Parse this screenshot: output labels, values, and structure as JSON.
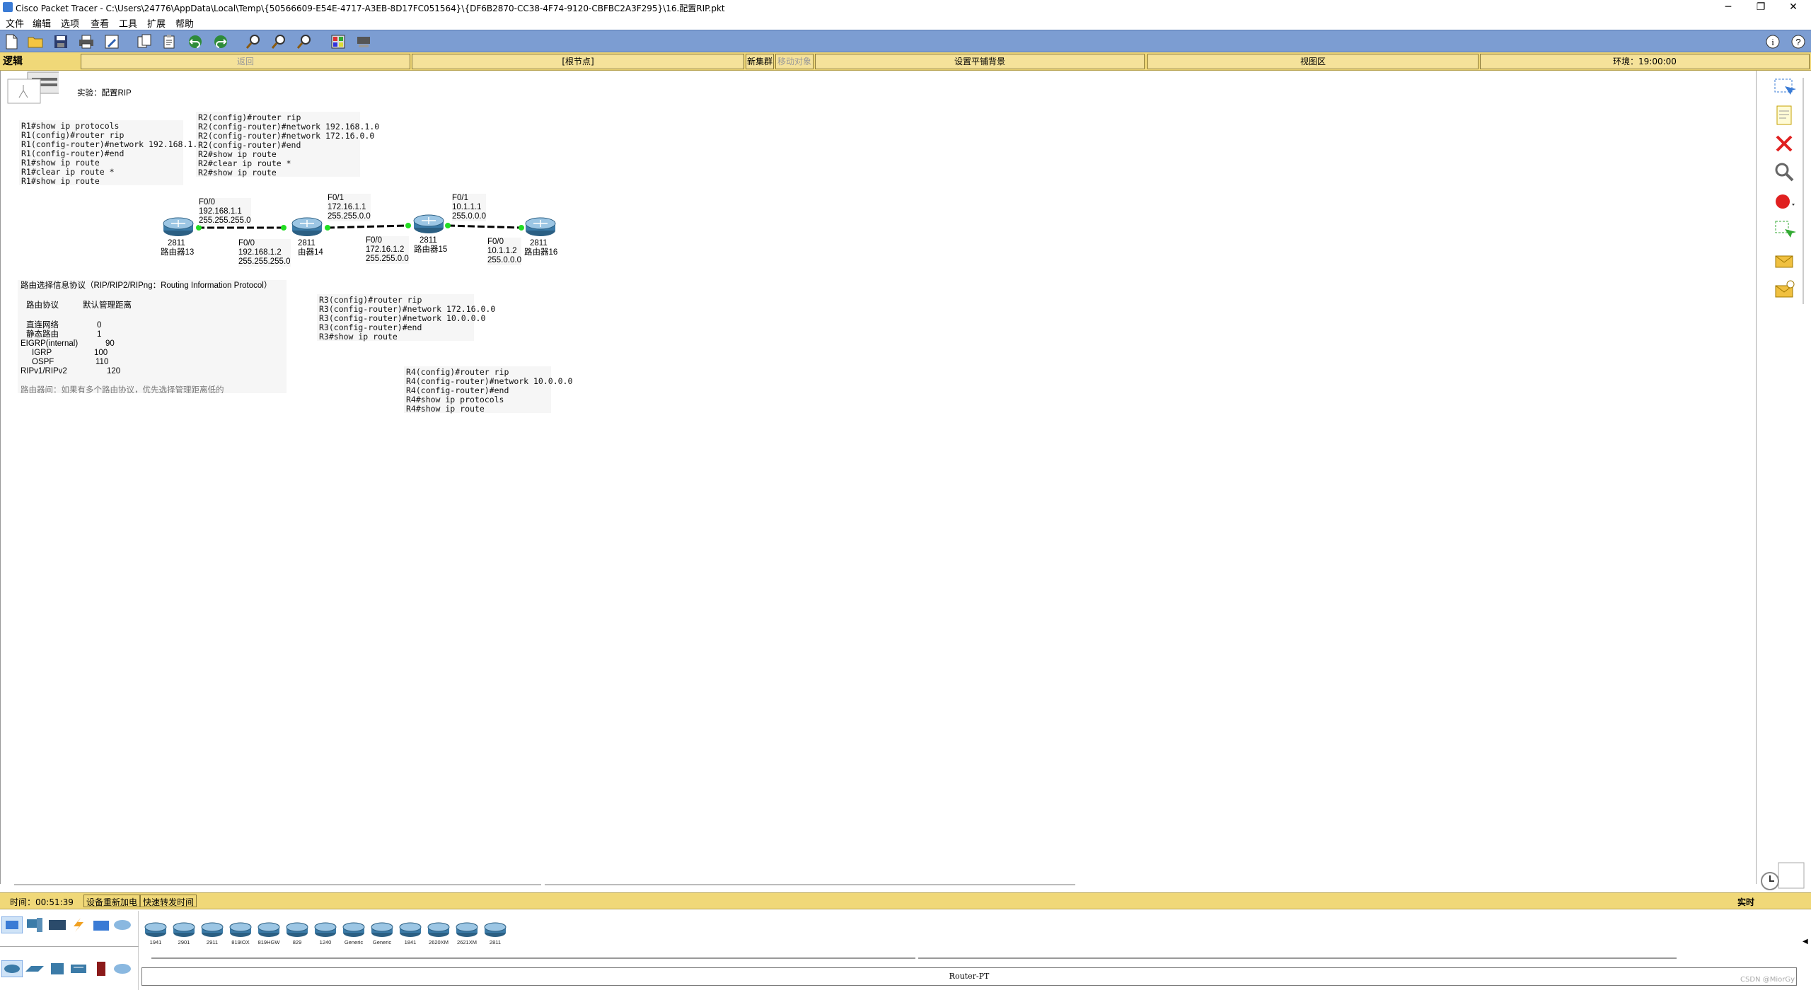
{
  "window": {
    "title": "Cisco Packet Tracer - C:\\Users\\24776\\AppData\\Local\\Temp\\{50566609-E54E-4717-A3EB-8D17FC051564}\\{DF6B2870-CC38-4F74-9120-CBFBC2A3F295}\\16.配置RIP.pkt",
    "minimize": "─",
    "maximize": "❐",
    "close": "✕"
  },
  "menu": [
    "文件",
    "编辑",
    "选项",
    "查看",
    "工具",
    "扩展",
    "帮助"
  ],
  "toolbar": {
    "icons": [
      "new-file-icon",
      "open-folder-icon",
      "save-icon",
      "print-icon",
      "activity-wizard-icon",
      "copy-icon",
      "paste-icon",
      "undo-icon",
      "redo-icon",
      "zoom-in-icon",
      "zoom-reset-icon",
      "zoom-out-icon",
      "palette-icon",
      "custom-device-icon"
    ],
    "right_icons": [
      "info-icon",
      "help-icon"
    ]
  },
  "nav": {
    "logic": "逻辑",
    "back": "返回",
    "root": "[根节点]",
    "new_cluster": "新集群",
    "move_object": "移动对象",
    "set_tiled_bg": "设置平铺背景",
    "viewport": "视图区",
    "environment": "环境：19:00:00"
  },
  "workspace": {
    "experiment_title": "实验：配置RIP",
    "notes": {
      "r1": "R1#show ip protocols\nR1(config)#router rip\nR1(config-router)#network 192.168.1.0\nR1(config-router)#end\nR1#show ip route\nR1#clear ip route *\nR1#show ip route",
      "r2": "R2(config)#router rip\nR2(config-router)#network 192.168.1.0\nR2(config-router)#network 172.16.0.0\nR2(config-router)#end\nR2#show ip route\nR2#clear ip route *\nR2#show ip route",
      "r3": "R3(config)#router rip\nR3(config-router)#network 172.16.0.0\nR3(config-router)#network 10.0.0.0\nR3(config-router)#end\nR3#show ip route",
      "r4": "R4(config)#router rip\nR4(config-router)#network 10.0.0.0\nR4(config-router)#end\nR4#show ip protocols\nR4#show ip route"
    },
    "protocol_note": {
      "header": "路由选择信息协议（RIP/RIP2/RIPng：Routing Information Protocol）",
      "col1": "路由协议",
      "col2": "默认管理距离",
      "rows": [
        {
          "name": "直连网络",
          "value": "0"
        },
        {
          "name": "静态路由",
          "value": "1"
        },
        {
          "name": "EIGRP(internal)",
          "value": "90"
        },
        {
          "name": "IGRP",
          "value": "100"
        },
        {
          "name": "OSPF",
          "value": "110"
        },
        {
          "name": "RIPv1/RIPv2",
          "value": "120"
        }
      ],
      "footer": "路由器间：如果有多个路由协议，优先选择管理距离低的"
    },
    "routers": [
      {
        "model": "2811",
        "name": "路由器13"
      },
      {
        "model": "2811",
        "name": "由器14"
      },
      {
        "model": "2811",
        "name": "路由器15"
      },
      {
        "model": "2811",
        "name": "路由器16"
      }
    ],
    "links": {
      "l1_top": "F0/0\n192.168.1.1\n255.255.255.0",
      "l1_bot": "F0/0\n192.168.1.2\n255.255.255.0",
      "l2_top": "F0/1\n172.16.1.1\n255.255.0.0",
      "l2_bot": "F0/0\n172.16.1.2\n255.255.0.0",
      "l3_top": "F0/1\n10.1.1.1\n255.0.0.0",
      "l3_bot": "F0/0\n10.1.1.2\n255.0.0.0"
    },
    "colors": {
      "link": "#000000",
      "port_up": "#22dd22"
    }
  },
  "right_toolbar": [
    "select-icon",
    "note-icon",
    "delete-icon",
    "inspect-icon",
    "draw-shape-icon",
    "resize-icon",
    "add-simple-pdu-icon",
    "add-complex-pdu-icon"
  ],
  "status": {
    "time": "时间：00:51:39",
    "power_cycle": "设备重新加电",
    "fast_forward": "快速转发时间",
    "realtime": "实时"
  },
  "device_panel": {
    "models": [
      "1941",
      "2901",
      "2911",
      "819IOX",
      "819HGW",
      "829",
      "1240",
      "Generic",
      "Generic",
      "1841",
      "2620XM",
      "2621XM",
      "2811"
    ],
    "selected_label": "Router-PT",
    "watermark": "CSDN @MiorGy"
  }
}
